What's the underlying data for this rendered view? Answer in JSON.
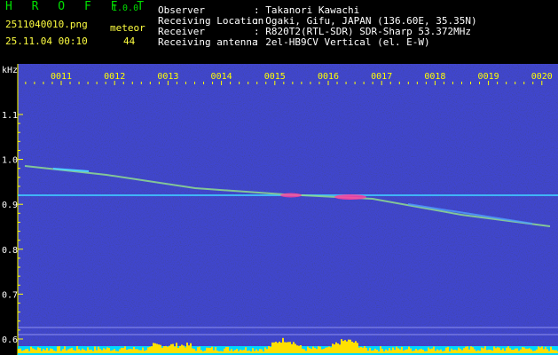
{
  "app": {
    "name": "H R O F F T",
    "version": "1.0.0"
  },
  "file": {
    "name": "2511040010.png",
    "datetime": "25.11.04 00:10"
  },
  "meteor": {
    "label": "meteor",
    "count": "44"
  },
  "info": [
    {
      "label": "Observer",
      "value": ": Takanori Kawachi"
    },
    {
      "label": "Receiving Location",
      "value": ": Ogaki, Gifu, JAPAN (136.60E, 35.35N)"
    },
    {
      "label": "Receiver",
      "value": ": R820T2(RTL-SDR) SDR-Sharp 53.372MHz"
    },
    {
      "label": "Receiving antenna",
      "value": ": 2el-HB9CV Vertical (el. E-W)"
    }
  ],
  "axis": {
    "y_unit": "kHz",
    "y_ticks": [
      "1.1",
      "1.0",
      "0.9",
      "0.8",
      "0.7",
      "0.6"
    ],
    "x_ticks": [
      "0011",
      "0012",
      "0013",
      "0014",
      "0015",
      "0016",
      "0017",
      "0018",
      "0019",
      "0020"
    ]
  },
  "colors": {
    "background": "#10104a",
    "ticks": "#ffff00",
    "carrier": "#40c8ff",
    "meteor": "#ff40a0"
  }
}
